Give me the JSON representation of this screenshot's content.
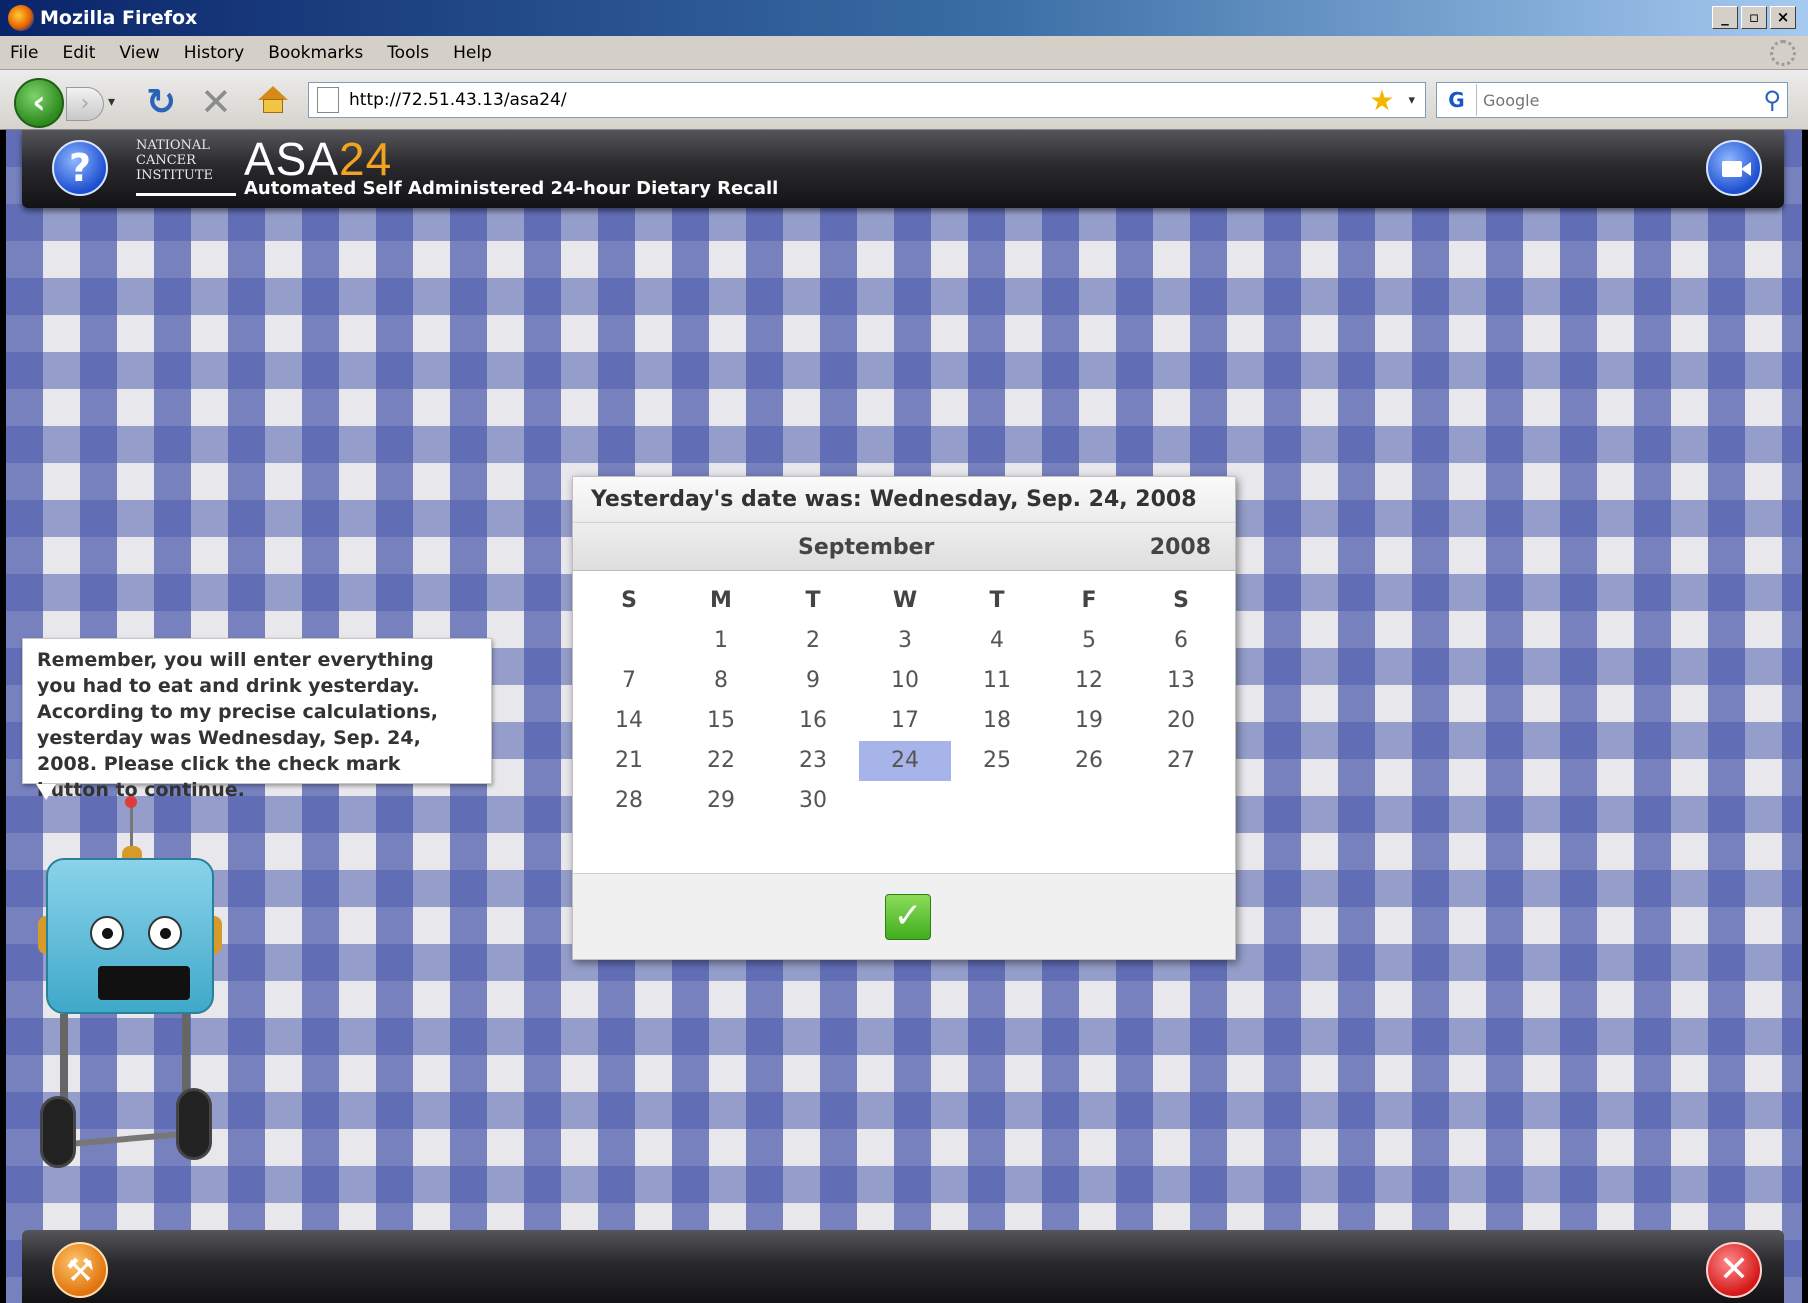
{
  "window": {
    "title": "Mozilla Firefox",
    "controls": [
      "_",
      "▫",
      "×"
    ]
  },
  "menu": {
    "items": [
      "File",
      "Edit",
      "View",
      "History",
      "Bookmarks",
      "Tools",
      "Help"
    ]
  },
  "navbar": {
    "url": "http://72.51.43.13/asa24/",
    "search_placeholder": "Google",
    "search_engine_icon": "G"
  },
  "app": {
    "logo_lines": [
      "NATIONAL",
      "CANCER",
      "INSTITUTE"
    ],
    "title_prefix": "ASA",
    "title_number": "24",
    "subtitle": "Automated Self Administered 24-hour Dietary Recall"
  },
  "bubble": {
    "text": "Remember, you will enter everything you had to eat and drink yesterday. According to my precise calculations, yesterday was Wednesday, Sep. 24, 2008. Please click the check mark button to continue."
  },
  "dialog": {
    "title_label": "Yesterday's date was:",
    "title_value": "Wednesday, Sep. 24, 2008",
    "month": "September",
    "year": "2008",
    "weekdays": [
      "S",
      "M",
      "T",
      "W",
      "T",
      "F",
      "S"
    ],
    "weeks": [
      [
        "",
        "1",
        "2",
        "3",
        "4",
        "5",
        "6"
      ],
      [
        "7",
        "8",
        "9",
        "10",
        "11",
        "12",
        "13"
      ],
      [
        "14",
        "15",
        "16",
        "17",
        "18",
        "19",
        "20"
      ],
      [
        "21",
        "22",
        "23",
        "24",
        "25",
        "26",
        "27"
      ],
      [
        "28",
        "29",
        "30",
        "",
        "",
        "",
        ""
      ]
    ],
    "selected_day": "24",
    "confirm_icon": "✓"
  },
  "colors": {
    "selected_day": "#a7b4ea",
    "accent_orange": "#f2a31f"
  }
}
